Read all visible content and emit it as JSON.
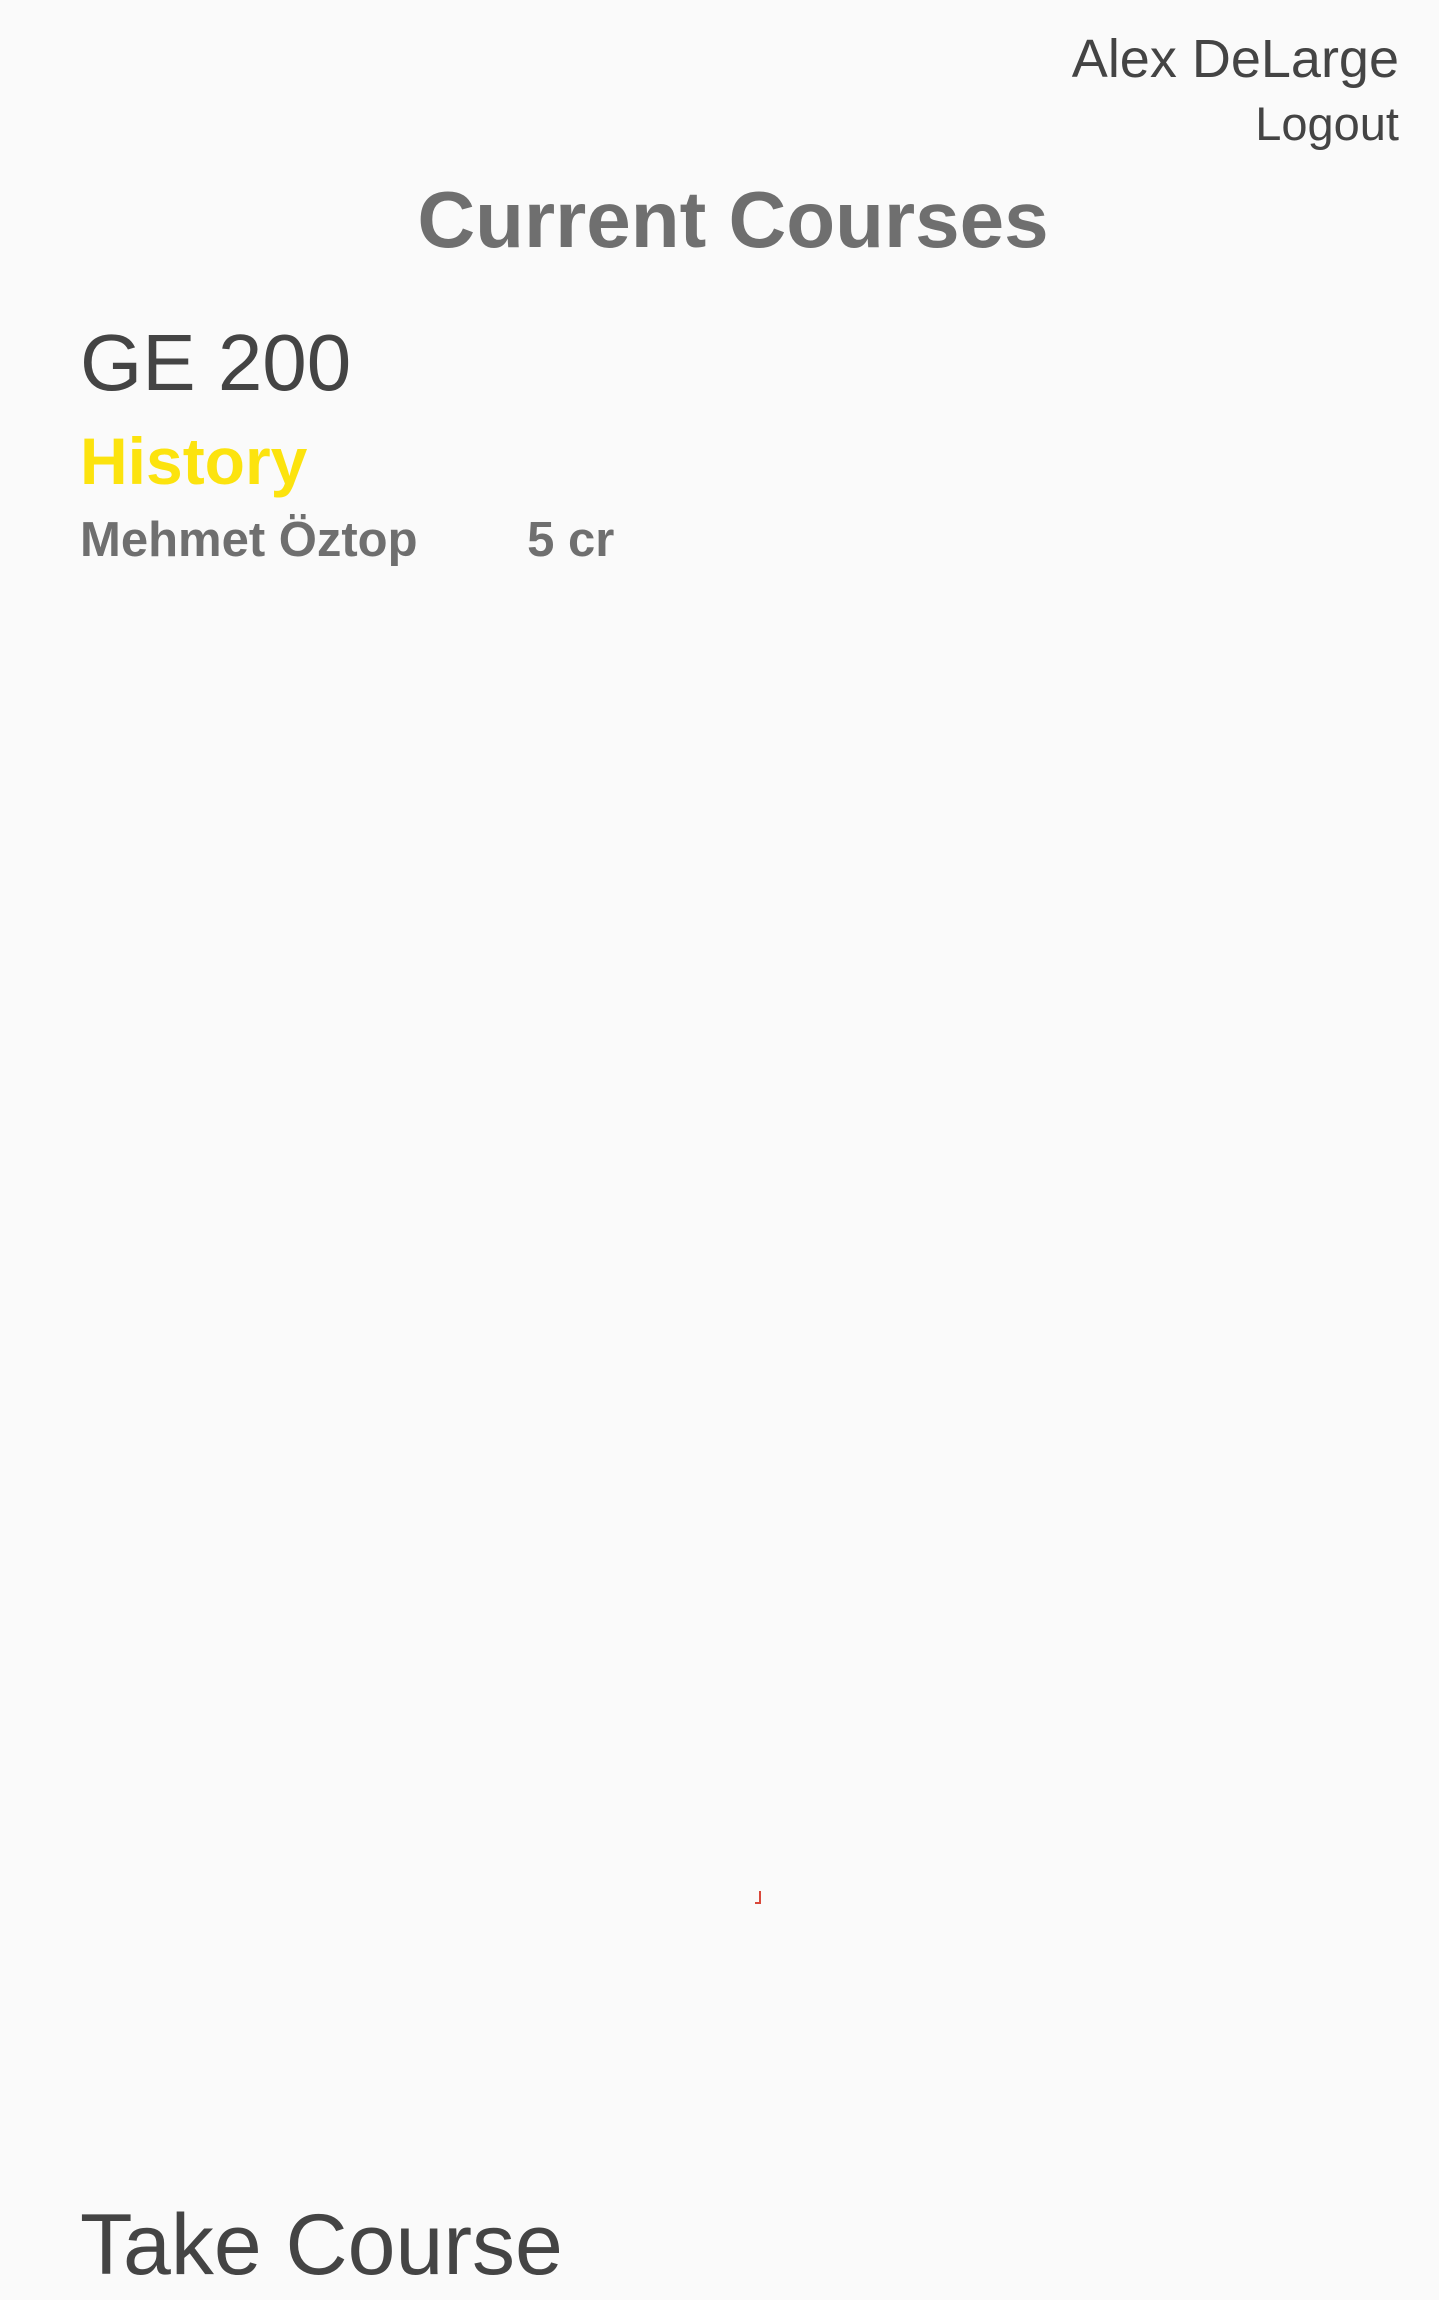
{
  "header": {
    "user_name": "Alex DeLarge",
    "logout_label": "Logout"
  },
  "page_title": "Current Courses",
  "courses": [
    {
      "code": "GE 200",
      "name": "History",
      "instructor": "Mehmet Öztop",
      "credits": "5 cr"
    }
  ],
  "take_course": {
    "heading": "Take Course"
  },
  "colors": {
    "background": "#fafafa",
    "text_dark": "#444444",
    "text_gray": "#6f6f6f",
    "accent_yellow": "#fce30e",
    "marker_red": "#d9483b"
  }
}
